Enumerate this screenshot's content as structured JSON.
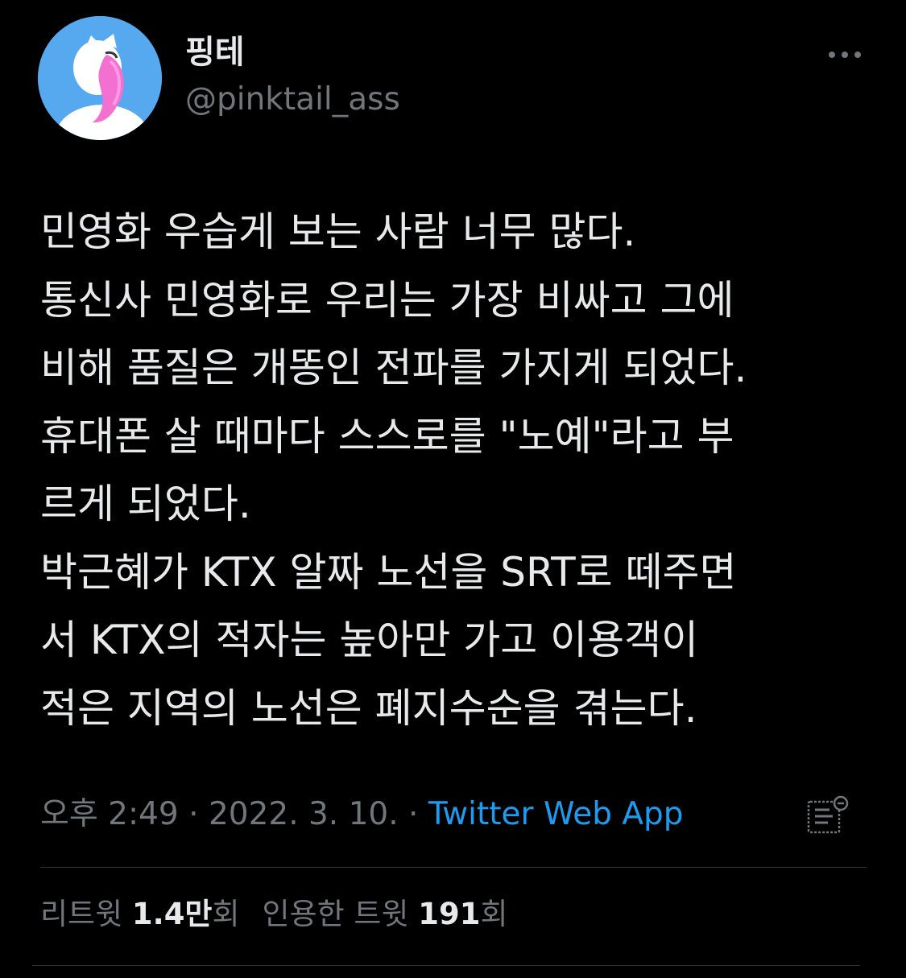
{
  "author": {
    "display_name": "핑테",
    "handle": "@pinktail_ass",
    "avatar_icon": "avatar-pink-tail-character",
    "avatar_bg": "#56a9ef"
  },
  "header": {
    "more_icon": "more-horizontal-icon"
  },
  "tweet": {
    "lines": [
      "민영화 우습게 보는 사람 너무 많다.",
      "통신사 민영화로 우리는 가장 비싸고 그에",
      "비해 품질은 개똥인 전파를 가지게 되었다.",
      "휴대폰 살 때마다 스스로를 \"노예\"라고 부",
      "르게 되었다.",
      "박근혜가 KTX 알짜 노선을 SRT로 떼주면",
      "서 KTX의 적자는 높아만 가고 이용객이",
      "적은 지역의 노선은 폐지수순을 겪는다."
    ]
  },
  "meta": {
    "time": "오후 2:49",
    "separator1": " · ",
    "date": "2022. 3. 10.",
    "separator2": " · ",
    "source": "Twitter Web App",
    "note_icon": "notes-edit-icon"
  },
  "stats": {
    "retweets_label": "리트윗",
    "retweets_value": "1.4만",
    "retweets_suffix": "회",
    "quotes_label": "인용한 트윗",
    "quotes_value": "191",
    "quotes_suffix": "회"
  },
  "colors": {
    "background": "#000000",
    "text_primary": "#e7e9ea",
    "text_secondary": "#71767b",
    "link": "#1d9bf0",
    "divider": "#2f3336"
  }
}
